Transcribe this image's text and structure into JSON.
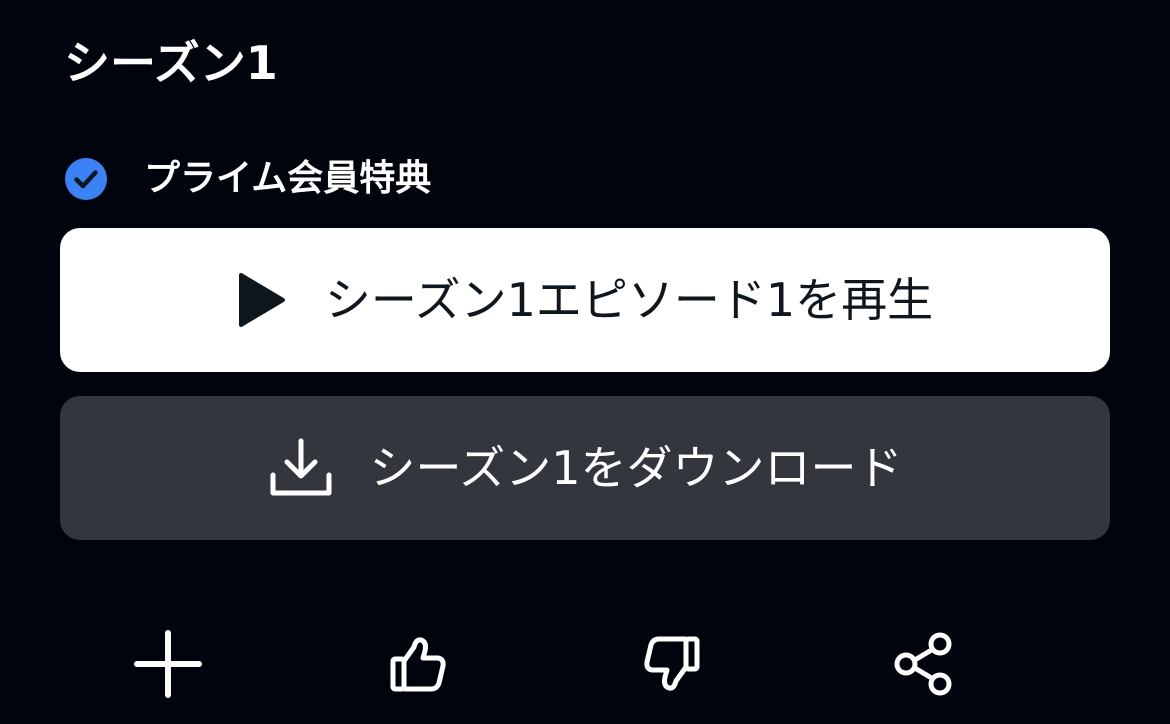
{
  "season": {
    "title": "シーズン1"
  },
  "prime": {
    "icon": "check-circle-icon",
    "label": "プライム会員特典",
    "accent": "#3b82f6"
  },
  "buttons": {
    "play": {
      "icon": "play-icon",
      "label": "シーズン1エピソード1を再生",
      "background": "#ffffff"
    },
    "download": {
      "icon": "download-icon",
      "label": "シーズン1をダウンロード",
      "background": "#33373d"
    }
  },
  "actions": [
    {
      "icon": "plus-icon"
    },
    {
      "icon": "thumbs-up-icon"
    },
    {
      "icon": "thumbs-down-icon"
    },
    {
      "icon": "share-icon"
    }
  ],
  "colors": {
    "page_background": "#00050d",
    "text": "#ffffff"
  }
}
